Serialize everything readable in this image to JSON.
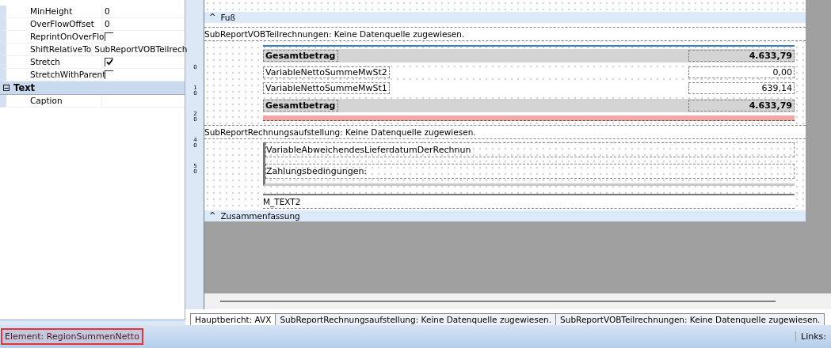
{
  "properties": [
    {
      "name": "MinHeight",
      "kind": "text",
      "value": "0"
    },
    {
      "name": "OverFlowOffset",
      "kind": "text",
      "value": "0"
    },
    {
      "name": "ReprintOnOverFlo",
      "kind": "checkbox",
      "checked": false
    },
    {
      "name": "ShiftRelativeTo",
      "kind": "text",
      "value": "SubReportVOBTeilrech"
    },
    {
      "name": "Stretch",
      "kind": "checkbox",
      "checked": true
    },
    {
      "name": "StretchWithParent",
      "kind": "checkbox",
      "checked": false
    }
  ],
  "property_group": {
    "toggle": "⊟",
    "title": "Text",
    "properties": [
      {
        "name": "Caption"
      }
    ]
  },
  "ruler_marks": [
    "0",
    "10",
    "20",
    "40",
    "50"
  ],
  "canvas": {
    "footer_band": {
      "toggle": "^",
      "title": "Fuß"
    },
    "subreport_vob": "SubReportVOBTeilrechnungen: Keine Datenquelle zugewiesen.",
    "region_rows": [
      {
        "kind": "total",
        "label": "Gesamtbetrag",
        "value": "4.633,79"
      },
      {
        "kind": "line",
        "label": "VariableNettoSummeMwSt2",
        "value": "0,00"
      },
      {
        "kind": "line",
        "label": "VariableNettoSummeMwSt1",
        "value": "639,14"
      },
      {
        "kind": "total",
        "label": "Gesamtbetrag",
        "value": "4.633,79"
      }
    ],
    "subreport_rechnung": "SubReportRechnungsaufstellung: Keine Datenquelle zugewiesen.",
    "detail_rows": [
      "VariableAbweichendesLieferdatumDerRechnun",
      "Zahlungsbedingungen:"
    ],
    "memo": "M_TEXT2",
    "summary_band": {
      "toggle": "^",
      "title": "Zusammenfassung"
    }
  },
  "tabs": [
    {
      "label": "Hauptbericht: AVX",
      "selected": true
    },
    {
      "label": "SubReportRechnungsaufstellung: Keine Datenquelle zugewiesen.",
      "selected": false
    },
    {
      "label": "SubReportVOBTeilrechnungen: Keine Datenquelle zugewiesen.",
      "selected": false
    }
  ],
  "status_bar": {
    "element": "Element: RegionSummenNetto",
    "links": "Links:"
  }
}
